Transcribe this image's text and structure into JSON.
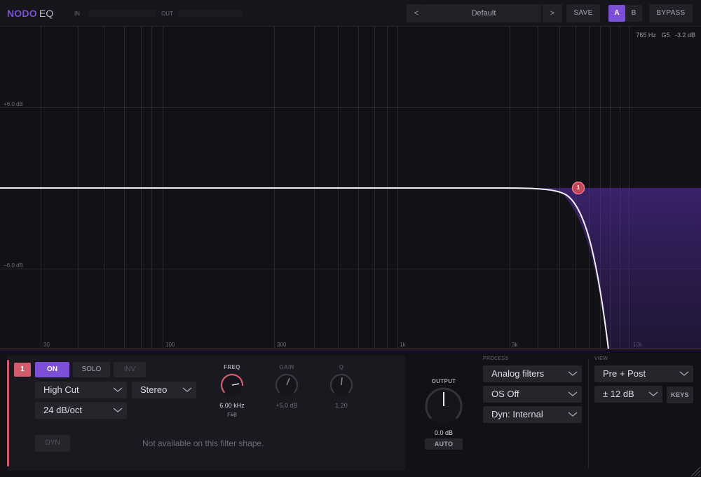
{
  "header": {
    "logo_primary": "NODO",
    "logo_secondary": "EQ",
    "meter_in_label": "IN",
    "meter_out_label": "OUT",
    "preset_prev": "<",
    "preset_name": "Default",
    "preset_next": ">",
    "save_label": "SAVE",
    "ab_a": "A",
    "ab_b": "B",
    "bypass_label": "BYPASS"
  },
  "graph": {
    "readout_freq": "765 Hz",
    "readout_note": "G5",
    "readout_db": "-3.2 dB",
    "db_plus": "+6.0 dB",
    "db_minus": "−6.0 dB",
    "freq_labels": [
      "30",
      "100",
      "300",
      "1k",
      "3k",
      "10k"
    ],
    "band_node_label": "1",
    "band_color": "#d35c6c",
    "accent_color": "#7b4fd6"
  },
  "band": {
    "number": "1",
    "on_label": "ON",
    "solo_label": "SOLO",
    "inv_label": "INV",
    "filter_type": "High Cut",
    "stereo_mode": "Stereo",
    "slope": "24 dB/oct",
    "freq_label": "FREQ",
    "freq_value": "6.00 kHz",
    "freq_note": "F#8",
    "gain_label": "GAIN",
    "gain_value": "+5.0 dB",
    "q_label": "Q",
    "q_value": "1.20",
    "dyn_label": "DYN",
    "unavailable_text": "Not available on this filter shape."
  },
  "output": {
    "label": "OUTPUT",
    "value": "0.0 dB",
    "auto_label": "AUTO"
  },
  "process": {
    "label": "PROCESS",
    "filters": "Analog filters",
    "oversampling": "OS Off",
    "dynamics": "Dyn: Internal"
  },
  "view": {
    "label": "VIEW",
    "mode": "Pre + Post",
    "range": "± 12 dB",
    "keys_label": "KEYS"
  }
}
